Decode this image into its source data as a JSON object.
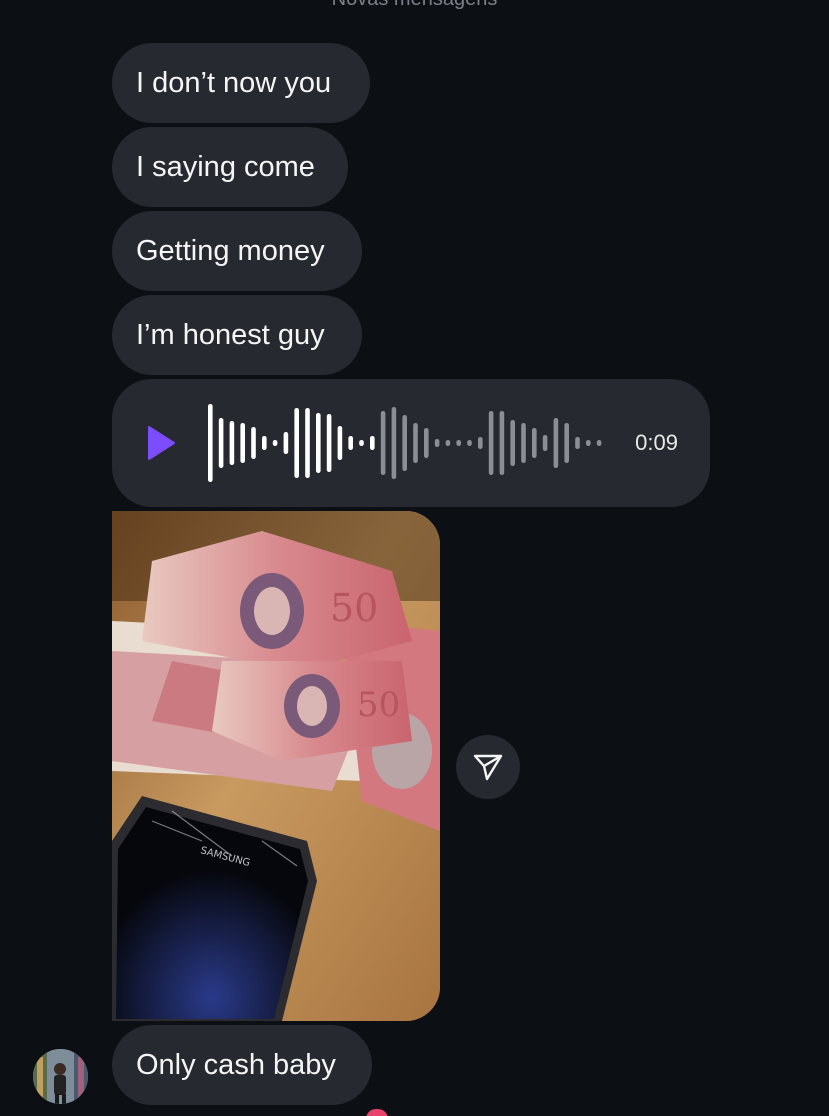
{
  "thread": {
    "divider_label": "Novas mensagens",
    "messages": [
      {
        "type": "text",
        "text": "I don’t now you"
      },
      {
        "type": "text",
        "text": "I saying come"
      },
      {
        "type": "text",
        "text": "Getting money"
      },
      {
        "type": "text",
        "text": "I’m honest guy"
      },
      {
        "type": "voice",
        "duration": "0:09",
        "played_fraction": 0.42
      },
      {
        "type": "photo"
      },
      {
        "type": "text",
        "text": "Only cash baby"
      }
    ]
  },
  "icons": {
    "play": "play-icon",
    "share": "paper-plane-icon",
    "reaction": "heart-icon"
  },
  "colors": {
    "background": "#0c1014",
    "bubble": "#262a30",
    "text": "#f5f5f5",
    "play_accent": "#7b4dff",
    "wave_played": "#ffffff",
    "wave_unplayed": "#8a8f96",
    "reaction": "#e8436c"
  }
}
